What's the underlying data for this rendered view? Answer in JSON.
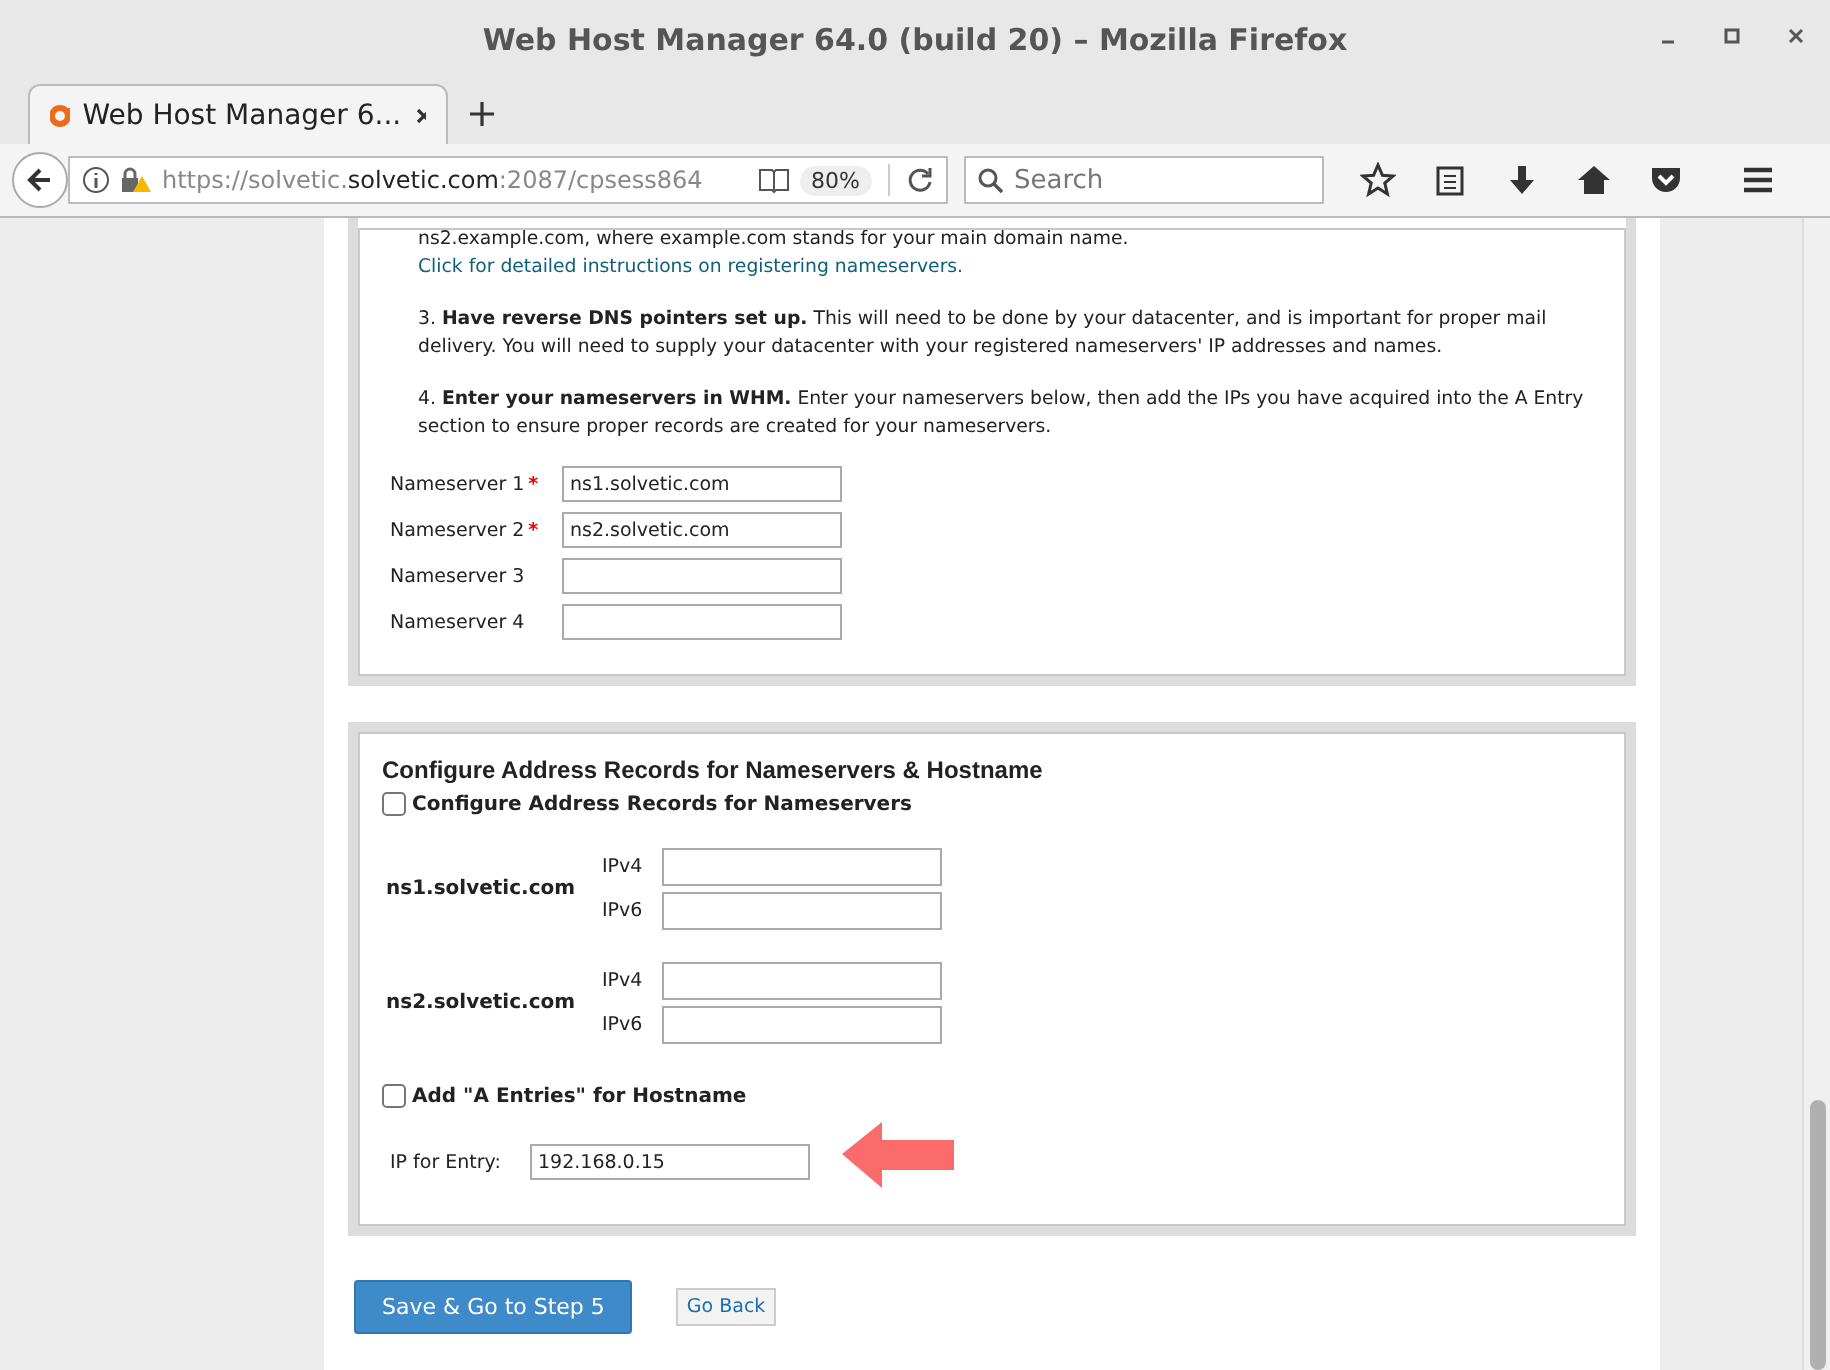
{
  "window": {
    "title": "Web Host Manager 64.0 (build 20) – Mozilla Firefox"
  },
  "tabs": [
    {
      "label": "Web Host Manager 6...",
      "selected": true
    }
  ],
  "address_bar": {
    "url_start": "https://solvetic.",
    "url_domain": "solvetic.com",
    "url_end": ":2087/cpsess864",
    "zoom": "80%"
  },
  "search": {
    "placeholder": "Search"
  },
  "intro": {
    "text": "ns2.example.com, where example.com stands for your main domain name.",
    "link": "Click for detailed instructions on registering nameservers."
  },
  "steps": [
    {
      "number": "3.",
      "heading": "Have reverse DNS pointers set up.",
      "text": "This will need to be done by your datacenter, and is important for proper mail delivery. You will need to supply your datacenter with your registered nameservers' IP addresses and names."
    },
    {
      "number": "4.",
      "heading": "Enter your nameservers in WHM.",
      "text": "Enter your nameservers below, then add the IPs you have acquired into the A Entry section to ensure proper records are created for your nameservers."
    }
  ],
  "nameservers": [
    {
      "label": "Nameserver 1",
      "required_mark": "*",
      "value": "ns1.solvetic.com"
    },
    {
      "label": "Nameserver 2",
      "required_mark": "*",
      "value": "ns2.solvetic.com"
    },
    {
      "label": "Nameserver 3"
    },
    {
      "label": "Nameserver 4"
    }
  ],
  "address_records": {
    "title": "Configure Address Records for Nameservers & Hostname",
    "configure_checkbox": {
      "label": "Configure Address Records for Nameservers",
      "checked": false
    },
    "hosts": [
      {
        "name": "ns1.solvetic.com",
        "fields": [
          "IPv4",
          "IPv6"
        ]
      },
      {
        "name": "ns2.solvetic.com",
        "fields": [
          "IPv4",
          "IPv6"
        ]
      }
    ],
    "hostname_checkbox": {
      "label": "Add \"A Entries\" for Hostname",
      "checked": false
    },
    "ip_entry": {
      "label": "IP for Entry:",
      "value": "192.168.0.15"
    }
  },
  "buttons": {
    "primary": "Save & Go to Step 5",
    "secondary": "Go Back"
  }
}
